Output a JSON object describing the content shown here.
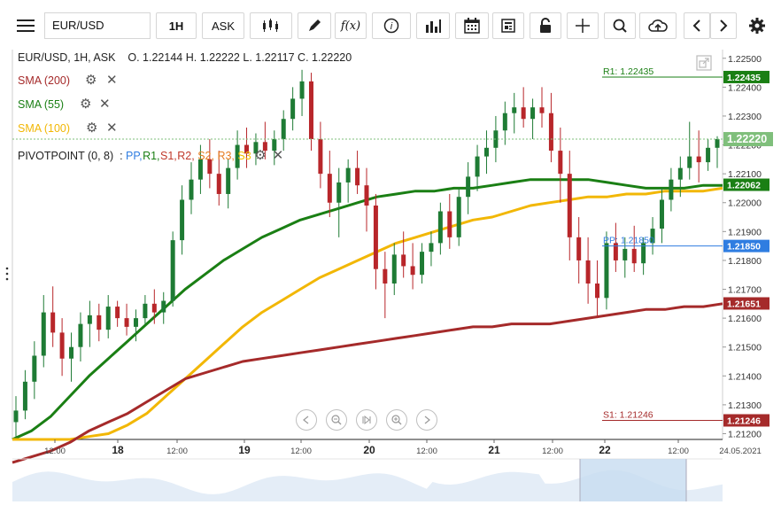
{
  "toolbar": {
    "symbol": "EUR/USD",
    "timeframe": "1H",
    "price_type": "ASK",
    "fx_label": "f(x)"
  },
  "header": {
    "symbol_line": "EUR/USD, 1H, ASK",
    "open_label": "O.",
    "open": "1.22144",
    "high_label": "H.",
    "high": "1.22222",
    "low_label": "L.",
    "low": "1.22117",
    "close_label": "C.",
    "close": "1.22220"
  },
  "indicators": [
    {
      "label": "SMA (200)",
      "color": "#a52a2a"
    },
    {
      "label": "SMA (55)",
      "color": "#1a7f14"
    },
    {
      "label": "SMA (100)",
      "color": "#f2b705"
    }
  ],
  "pivot": {
    "label": "PIVOTPOINT (0, 8)",
    "sep": ":",
    "parts": [
      {
        "text": "PP,",
        "color": "#2f7de1"
      },
      {
        "text": "R1,",
        "color": "#1a7f14"
      },
      {
        "text": "S1,",
        "color": "#c0392b"
      },
      {
        "text": "R2,",
        "color": "#c0392b"
      },
      {
        "text": "S2,",
        "color": "#e67e22"
      },
      {
        "text": "R3,",
        "color": "#e67e22"
      },
      {
        "text": "S3",
        "color": "#f2c200"
      }
    ]
  },
  "chart_data": {
    "type": "candlestick",
    "symbol": "EUR/USD",
    "interval": "1H",
    "ylim": [
      1.2118,
      1.2253
    ],
    "y_ticks": [
      "1.22500",
      "1.22400",
      "1.22300",
      "1.22200",
      "1.22100",
      "1.22000",
      "1.21900",
      "1.21800",
      "1.21700",
      "1.21600",
      "1.21500",
      "1.21400",
      "1.21300",
      "1.21200"
    ],
    "x_ticks": [
      "12:00",
      "18",
      "12:00",
      "19",
      "12:00",
      "20",
      "12:00",
      "21",
      "12:00",
      "22",
      "12:00",
      "24.05.2021"
    ],
    "x_bold_ticks": [
      "18",
      "19",
      "20",
      "21",
      "22"
    ],
    "price_badges": [
      {
        "value": "1.22435",
        "color": "#1a7f14"
      },
      {
        "value": "1.22220",
        "color": "#7fbf7b"
      },
      {
        "value": "1.22062",
        "color": "#1a7f14"
      },
      {
        "value": "1.21850",
        "color": "#2f7de1"
      },
      {
        "value": "1.21651",
        "color": "#a52a2a"
      },
      {
        "value": "1.21246",
        "color": "#a52a2a"
      }
    ],
    "level_labels": [
      {
        "text": "R1: 1.22435",
        "value": 1.22435,
        "color": "#1a7f14"
      },
      {
        "text": "PP: 1.21850",
        "value": 1.2185,
        "color": "#2f7de1"
      },
      {
        "text": "S1: 1.21246",
        "value": 1.21246,
        "color": "#a52a2a"
      }
    ],
    "last_close": 1.2222,
    "candles": [
      [
        1.2124,
        1.2133,
        1.2119,
        1.2128
      ],
      [
        1.2128,
        1.2142,
        1.2125,
        1.2138
      ],
      [
        1.2138,
        1.2152,
        1.2132,
        1.2147
      ],
      [
        1.2147,
        1.2168,
        1.2143,
        1.2162
      ],
      [
        1.2162,
        1.2171,
        1.215,
        1.2155
      ],
      [
        1.2155,
        1.216,
        1.214,
        1.2146
      ],
      [
        1.2146,
        1.2155,
        1.2138,
        1.215
      ],
      [
        1.215,
        1.2162,
        1.2145,
        1.2158
      ],
      [
        1.2158,
        1.2166,
        1.215,
        1.2161
      ],
      [
        1.2161,
        1.2165,
        1.2152,
        1.2156
      ],
      [
        1.2156,
        1.2168,
        1.2153,
        1.2164
      ],
      [
        1.2164,
        1.2166,
        1.2157,
        1.216
      ],
      [
        1.216,
        1.2165,
        1.2154,
        1.2157
      ],
      [
        1.2157,
        1.2163,
        1.2152,
        1.216
      ],
      [
        1.216,
        1.2168,
        1.2158,
        1.2165
      ],
      [
        1.2165,
        1.217,
        1.2158,
        1.2162
      ],
      [
        1.2162,
        1.2169,
        1.2158,
        1.2166
      ],
      [
        1.2166,
        1.219,
        1.2164,
        1.2187
      ],
      [
        1.2187,
        1.2206,
        1.2182,
        1.2201
      ],
      [
        1.2201,
        1.2214,
        1.2196,
        1.2208
      ],
      [
        1.2208,
        1.222,
        1.2203,
        1.2215
      ],
      [
        1.2215,
        1.2222,
        1.2205,
        1.221
      ],
      [
        1.221,
        1.2218,
        1.2199,
        1.2203
      ],
      [
        1.2203,
        1.2215,
        1.2198,
        1.2212
      ],
      [
        1.2212,
        1.2225,
        1.2208,
        1.222
      ],
      [
        1.222,
        1.2226,
        1.2212,
        1.2217
      ],
      [
        1.2217,
        1.2224,
        1.2213,
        1.2221
      ],
      [
        1.2221,
        1.2228,
        1.2215,
        1.2218
      ],
      [
        1.2218,
        1.2225,
        1.2213,
        1.2222
      ],
      [
        1.2222,
        1.2232,
        1.2218,
        1.2229
      ],
      [
        1.2229,
        1.224,
        1.2225,
        1.2236
      ],
      [
        1.2236,
        1.2246,
        1.223,
        1.2242
      ],
      [
        1.2242,
        1.2245,
        1.2218,
        1.2222
      ],
      [
        1.2222,
        1.2228,
        1.2205,
        1.221
      ],
      [
        1.221,
        1.2218,
        1.2195,
        1.22
      ],
      [
        1.22,
        1.2212,
        1.2188,
        1.2207
      ],
      [
        1.2207,
        1.2215,
        1.22,
        1.2212
      ],
      [
        1.2212,
        1.2218,
        1.2203,
        1.2206
      ],
      [
        1.2206,
        1.2212,
        1.219,
        1.2199
      ],
      [
        1.2199,
        1.2203,
        1.217,
        1.2177
      ],
      [
        1.2177,
        1.2183,
        1.216,
        1.2172
      ],
      [
        1.2172,
        1.2186,
        1.2168,
        1.2182
      ],
      [
        1.2182,
        1.219,
        1.2174,
        1.2178
      ],
      [
        1.2178,
        1.2186,
        1.217,
        1.2175
      ],
      [
        1.2175,
        1.2186,
        1.2172,
        1.2183
      ],
      [
        1.2183,
        1.219,
        1.2178,
        1.2186
      ],
      [
        1.2186,
        1.22,
        1.2182,
        1.2197
      ],
      [
        1.2197,
        1.2203,
        1.2184,
        1.2188
      ],
      [
        1.2188,
        1.2205,
        1.2185,
        1.2202
      ],
      [
        1.2202,
        1.2214,
        1.2196,
        1.2209
      ],
      [
        1.2209,
        1.222,
        1.2204,
        1.2216
      ],
      [
        1.2216,
        1.2225,
        1.221,
        1.2219
      ],
      [
        1.2219,
        1.223,
        1.2214,
        1.2225
      ],
      [
        1.2225,
        1.2235,
        1.222,
        1.2231
      ],
      [
        1.2231,
        1.2238,
        1.2224,
        1.2233
      ],
      [
        1.2233,
        1.224,
        1.2226,
        1.2229
      ],
      [
        1.2229,
        1.2236,
        1.2222,
        1.2233
      ],
      [
        1.2233,
        1.224,
        1.2226,
        1.2231
      ],
      [
        1.2231,
        1.2238,
        1.2214,
        1.2218
      ],
      [
        1.2218,
        1.2226,
        1.22,
        1.221
      ],
      [
        1.221,
        1.2218,
        1.218,
        1.2188
      ],
      [
        1.2188,
        1.2195,
        1.2172,
        1.218
      ],
      [
        1.218,
        1.2188,
        1.2165,
        1.2172
      ],
      [
        1.2172,
        1.218,
        1.216,
        1.2167
      ],
      [
        1.2167,
        1.219,
        1.2163,
        1.2186
      ],
      [
        1.2186,
        1.2193,
        1.2176,
        1.218
      ],
      [
        1.218,
        1.2188,
        1.2174,
        1.2184
      ],
      [
        1.2184,
        1.2192,
        1.2176,
        1.2179
      ],
      [
        1.2179,
        1.2188,
        1.2175,
        1.2186
      ],
      [
        1.2186,
        1.2195,
        1.2182,
        1.2191
      ],
      [
        1.2191,
        1.2205,
        1.2186,
        1.2201
      ],
      [
        1.2201,
        1.2212,
        1.2197,
        1.2208
      ],
      [
        1.2208,
        1.2216,
        1.2202,
        1.2212
      ],
      [
        1.2212,
        1.2228,
        1.2208,
        1.2216
      ],
      [
        1.2216,
        1.2225,
        1.2207,
        1.2214
      ],
      [
        1.2214,
        1.2222,
        1.2211,
        1.2219
      ],
      [
        1.2219,
        1.2223,
        1.2212,
        1.2222
      ]
    ],
    "series": [
      {
        "name": "SMA (55)",
        "color": "#1a7f14",
        "values": [
          1.2118,
          1.2121,
          1.2126,
          1.2133,
          1.214,
          1.2146,
          1.2152,
          1.2158,
          1.2164,
          1.217,
          1.2175,
          1.218,
          1.2184,
          1.2188,
          1.2191,
          1.2194,
          1.2196,
          1.2198,
          1.22,
          1.2202,
          1.2203,
          1.2204,
          1.2204,
          1.2205,
          1.2205,
          1.2206,
          1.2207,
          1.2208,
          1.2208,
          1.2208,
          1.2208,
          1.2207,
          1.2206,
          1.2205,
          1.2205,
          1.2205,
          1.2206,
          1.2206
        ]
      },
      {
        "name": "SMA (100)",
        "color": "#f2b705",
        "values": [
          1.2118,
          1.2118,
          1.2118,
          1.2118,
          1.2119,
          1.212,
          1.2123,
          1.2127,
          1.2133,
          1.2139,
          1.2145,
          1.2151,
          1.2157,
          1.2162,
          1.2166,
          1.217,
          1.2174,
          1.2177,
          1.218,
          1.2183,
          1.2186,
          1.2188,
          1.219,
          1.2192,
          1.2194,
          1.2195,
          1.2197,
          1.2199,
          1.22,
          1.2201,
          1.2202,
          1.2202,
          1.2203,
          1.2203,
          1.2204,
          1.2204,
          1.2204,
          1.2205
        ]
      },
      {
        "name": "SMA (200)",
        "color": "#a52a2a",
        "values": [
          1.211,
          1.2112,
          1.2114,
          1.2117,
          1.2121,
          1.2124,
          1.2127,
          1.2131,
          1.2135,
          1.2139,
          1.2141,
          1.2143,
          1.2145,
          1.2146,
          1.2147,
          1.2148,
          1.2149,
          1.215,
          1.2151,
          1.2152,
          1.2153,
          1.2154,
          1.2155,
          1.2156,
          1.2157,
          1.2157,
          1.2158,
          1.2158,
          1.2158,
          1.2159,
          1.216,
          1.2161,
          1.2162,
          1.2163,
          1.2163,
          1.2164,
          1.2164,
          1.2165
        ]
      }
    ]
  }
}
